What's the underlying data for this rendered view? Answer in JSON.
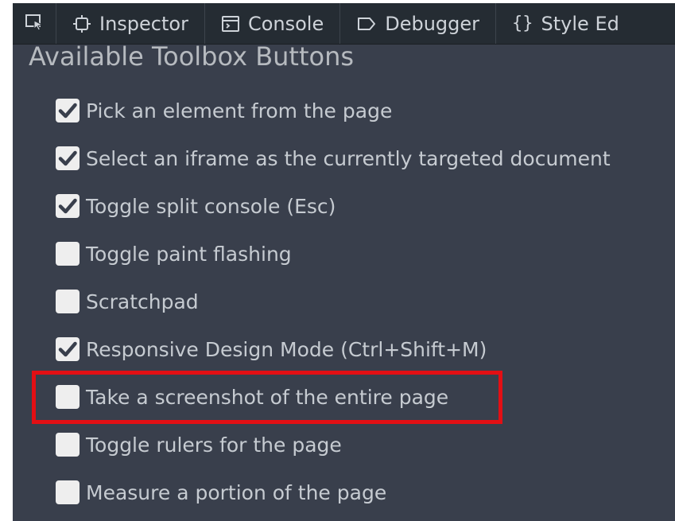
{
  "toolbar": {
    "picker_icon": "element-picker-icon",
    "tabs": [
      {
        "label": "Inspector",
        "icon": "inspector-icon"
      },
      {
        "label": "Console",
        "icon": "console-icon"
      },
      {
        "label": "Debugger",
        "icon": "debugger-icon"
      },
      {
        "label": "Style Ed",
        "icon": "style-editor-icon"
      }
    ]
  },
  "panel": {
    "heading": "Available Toolbox Buttons",
    "options": [
      {
        "label": "Pick an element from the page",
        "checked": true
      },
      {
        "label": "Select an iframe as the currently targeted document",
        "checked": true
      },
      {
        "label": "Toggle split console (Esc)",
        "checked": true
      },
      {
        "label": "Toggle paint flashing",
        "checked": false
      },
      {
        "label": "Scratchpad",
        "checked": false
      },
      {
        "label": "Responsive Design Mode (Ctrl+Shift+M)",
        "checked": true
      },
      {
        "label": "Take a screenshot of the entire page",
        "checked": false
      },
      {
        "label": "Toggle rulers for the page",
        "checked": false
      },
      {
        "label": "Measure a portion of the page",
        "checked": false
      }
    ],
    "highlighted_option": "Take a screenshot of the entire page"
  },
  "colors": {
    "panel_background": "#393f4c",
    "toolbar_background": "#252c33",
    "text": "#c6cbd1",
    "checkbox": "#eeeeee",
    "checkmark": "#393f4c",
    "highlight_border": "#e30f14"
  }
}
